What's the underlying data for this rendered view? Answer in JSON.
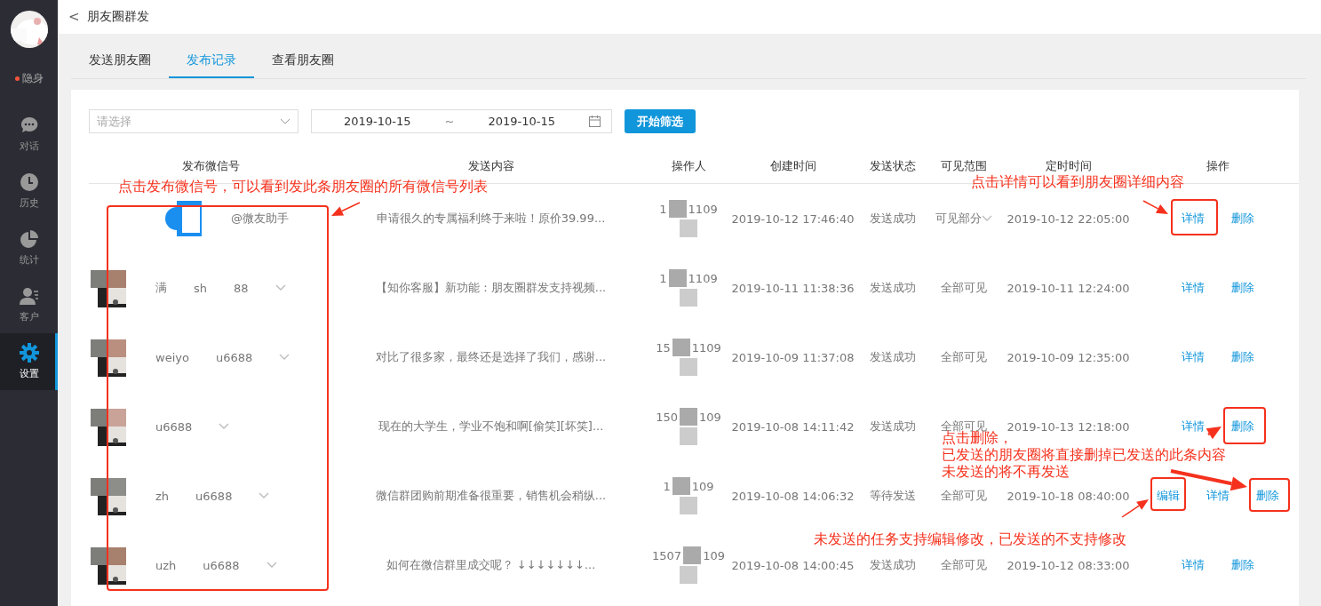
{
  "sidebar": {
    "status": "隐身",
    "items": [
      {
        "label": "对话",
        "selected": false
      },
      {
        "label": "历史",
        "selected": false
      },
      {
        "label": "统计",
        "selected": false
      },
      {
        "label": "客户",
        "selected": false
      },
      {
        "label": "设置",
        "selected": true
      }
    ]
  },
  "header": {
    "back": "<",
    "title": "朋友圈群发"
  },
  "tabs": [
    {
      "label": "发送朋友圈",
      "selected": false
    },
    {
      "label": "发布记录",
      "selected": true
    },
    {
      "label": "查看朋友圈",
      "selected": false
    }
  ],
  "filter": {
    "select_placeholder": "请选择",
    "date_from": "2019-10-15",
    "separator": "~",
    "date_to": "2019-10-15",
    "button": "开始筛选"
  },
  "table": {
    "columns": [
      "发布微信号",
      "发送内容",
      "操作人",
      "创建时间",
      "发送状态",
      "可见范围",
      "定时时间",
      "操作"
    ],
    "rows": [
      {
        "wechat": [
          "@微友助手"
        ],
        "wechat_dropdown": false,
        "content": "申请很久的专属福利终于来啦！原价39.99...",
        "operator": [
          "1",
          "1109"
        ],
        "created": "2019-10-12 17:46:40",
        "status": "发送成功",
        "visible": "可见部分",
        "visible_dropdown": true,
        "scheduled": "2019-10-12 22:05:00",
        "actions": [
          "详情",
          "删除"
        ]
      },
      {
        "wechat": [
          "满",
          "sh",
          "88"
        ],
        "wechat_dropdown": true,
        "content": "【知你客服】新功能：朋友圈群发支持视频...",
        "operator": [
          "1",
          "1109"
        ],
        "created": "2019-10-11 11:38:36",
        "status": "发送成功",
        "visible": "全部可见",
        "visible_dropdown": false,
        "scheduled": "2019-10-11 12:24:00",
        "actions": [
          "详情",
          "删除"
        ]
      },
      {
        "wechat": [
          "weiyo",
          "u6688"
        ],
        "wechat_dropdown": true,
        "content": "对比了很多家，最终还是选择了我们，感谢...",
        "operator": [
          "15",
          "1109"
        ],
        "created": "2019-10-09 11:37:08",
        "status": "发送成功",
        "visible": "全部可见",
        "visible_dropdown": false,
        "scheduled": "2019-10-09 12:35:00",
        "actions": [
          "详情",
          "删除"
        ]
      },
      {
        "wechat": [
          "u6688"
        ],
        "wechat_dropdown": true,
        "content": "现在的大学生，学业不饱和啊[偷笑][坏笑]...",
        "operator": [
          "150",
          "109"
        ],
        "created": "2019-10-08 14:11:42",
        "status": "发送成功",
        "visible": "全部可见",
        "visible_dropdown": false,
        "scheduled": "2019-10-13 12:18:00",
        "actions": [
          "详情",
          "删除"
        ]
      },
      {
        "wechat": [
          "zh",
          "u6688"
        ],
        "wechat_dropdown": true,
        "content": "微信群团购前期准备很重要，销售机会稍纵...",
        "operator": [
          "1",
          "109"
        ],
        "created": "2019-10-08 14:06:32",
        "status": "等待发送",
        "visible": "全部可见",
        "visible_dropdown": false,
        "scheduled": "2019-10-18 08:40:00",
        "actions": [
          "编辑",
          "详情",
          "删除"
        ]
      },
      {
        "wechat": [
          "uzh",
          "u6688"
        ],
        "wechat_dropdown": true,
        "content": "如何在微信群里成交呢？ ↓↓↓↓↓↓↓...",
        "operator": [
          "1507",
          "109"
        ],
        "created": "2019-10-08 14:00:45",
        "status": "发送成功",
        "visible": "全部可见",
        "visible_dropdown": false,
        "scheduled": "2019-10-12 08:33:00",
        "actions": [
          "详情",
          "删除"
        ]
      }
    ]
  },
  "annotations": [
    {
      "kind": "wechat",
      "text": "点击发布微信号，可以看到发此条朋友圈的所有微信号列表"
    },
    {
      "kind": "detail",
      "text": "点击详情可以看到朋友圈详细内容"
    },
    {
      "kind": "delete",
      "lines": [
        "点击删除，",
        "已发送的朋友圈将直接删掉已发送的此条内容",
        "未发送的将不再发送"
      ]
    },
    {
      "kind": "edit",
      "text": "未发送的任务支持编辑修改，已发送的不支持修改"
    }
  ]
}
